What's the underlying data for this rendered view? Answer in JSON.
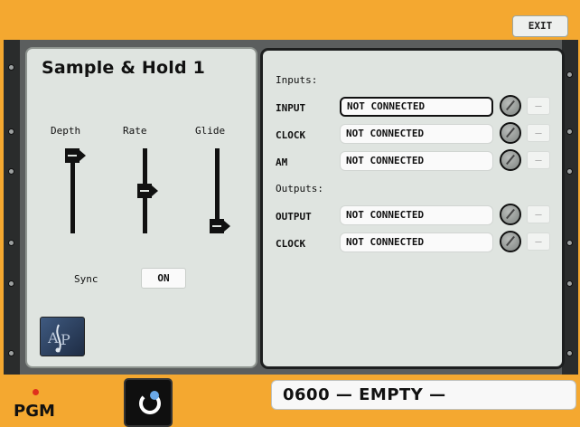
{
  "header": {
    "exit_label": "EXIT"
  },
  "module": {
    "title": "Sample & Hold 1",
    "sliders": [
      {
        "label": "Depth",
        "level": 1.0
      },
      {
        "label": "Rate",
        "level": 0.5
      },
      {
        "label": "Glide",
        "level": 0.0
      }
    ],
    "sync": {
      "label": "Sync",
      "value": "ON"
    },
    "logo_icon": "a-and-p-logo-icon"
  },
  "connections": {
    "inputs_label": "Inputs:",
    "outputs_label": "Outputs:",
    "inputs": [
      {
        "label": "INPUT",
        "value": "NOT CONNECTED",
        "minus": "—"
      },
      {
        "label": "CLOCK",
        "value": "NOT CONNECTED",
        "minus": "—"
      },
      {
        "label": "AM",
        "value": "NOT CONNECTED",
        "minus": "—"
      }
    ],
    "outputs": [
      {
        "label": "OUTPUT",
        "value": "NOT CONNECTED",
        "minus": "—"
      },
      {
        "label": "CLOCK",
        "value": "NOT CONNECTED",
        "minus": "—"
      }
    ]
  },
  "footer": {
    "pgm_label": "PGM",
    "preset": "0600 — EMPTY —"
  },
  "colors": {
    "background": "#f4a830",
    "panel": "#dfe4e0",
    "led": "#e0301c"
  }
}
